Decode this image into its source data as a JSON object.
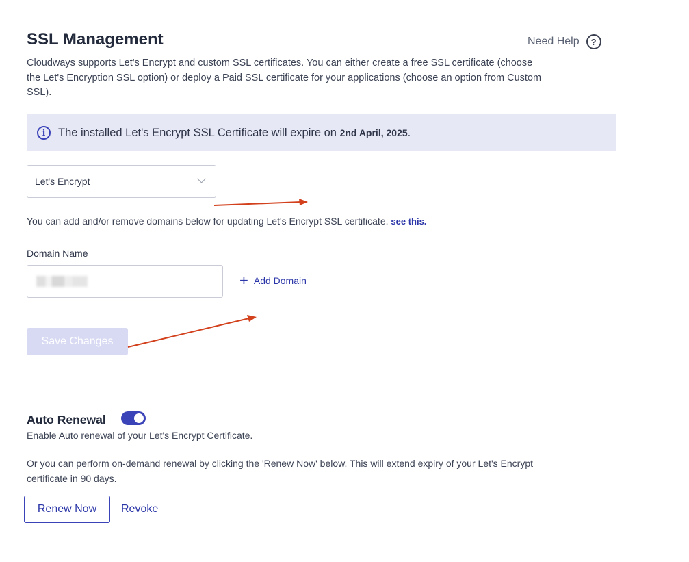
{
  "page": {
    "title": "SSL Management",
    "help_label": "Need Help",
    "description": "Cloudways supports Let's Encrypt and custom SSL certificates. You can either create a free SSL certificate (choose the Let's Encryption SSL option) or deploy a Paid SSL certificate for your applications (choose an option from Custom SSL)."
  },
  "banner": {
    "text": "The installed Let's Encrypt SSL Certificate will expire on ",
    "date": "2nd April, 2025",
    "suffix": "."
  },
  "ssl_select": {
    "value": "Let's Encrypt"
  },
  "domains": {
    "info_text": "You can add and/or remove domains below for updating Let's Encrypt SSL certificate. ",
    "see_this": "see this.",
    "label": "Domain Name",
    "add_label": "Add Domain",
    "save_label": "Save Changes"
  },
  "auto_renewal": {
    "title": "Auto Renewal",
    "enabled": true,
    "description": "Enable Auto renewal of your Let's Encrypt Certificate.",
    "ondemand_text": "Or you can perform on-demand renewal by clicking the 'Renew Now' below. This will extend expiry of your Let's Encrypt certificate in 90 days.",
    "renew_label": "Renew Now",
    "revoke_label": "Revoke"
  },
  "colors": {
    "accent": "#3b43b8",
    "annotation_arrow": "#d2401c",
    "banner_bg": "#e7e8f6"
  },
  "icons": [
    "question-circle-icon",
    "info-circle-icon",
    "chevron-down-icon",
    "plus-icon"
  ]
}
